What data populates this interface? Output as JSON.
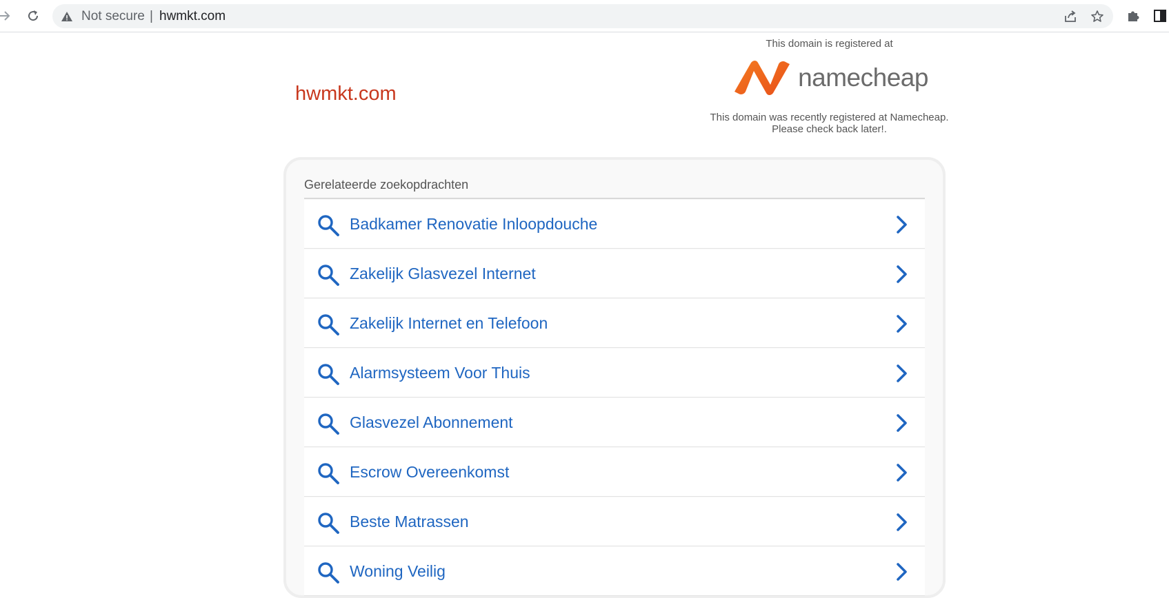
{
  "browser": {
    "security_label": "Not secure",
    "separator": "|",
    "url": "hwmkt.com"
  },
  "page": {
    "domain_name": "hwmkt.com",
    "registrar_intro": "This domain is registered at",
    "registrar_logo_text": "namecheap",
    "registrar_note_line1": "This domain was recently registered at Namecheap.",
    "registrar_note_line2": "Please check back later!."
  },
  "related": {
    "heading": "Gerelateerde zoekopdrachten",
    "items": [
      {
        "label": "Badkamer Renovatie Inloopdouche"
      },
      {
        "label": "Zakelijk Glasvezel Internet"
      },
      {
        "label": "Zakelijk Internet en Telefoon"
      },
      {
        "label": "Alarmsysteem Voor Thuis"
      },
      {
        "label": "Glasvezel Abonnement"
      },
      {
        "label": "Escrow Overeenkomst"
      },
      {
        "label": "Beste Matrassen"
      },
      {
        "label": "Woning Veilig"
      }
    ]
  },
  "colors": {
    "domain_title": "#c8381e",
    "link_blue": "#1f66c1",
    "logo_orange": "#f26a21"
  }
}
